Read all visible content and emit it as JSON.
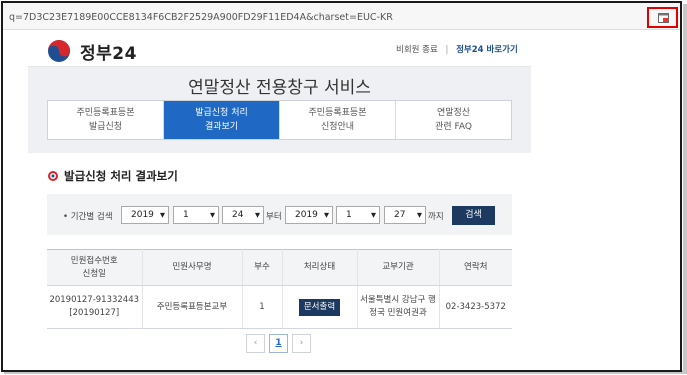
{
  "browser": {
    "url": "q=7D3C23E7189E00CCE8134F6CB2F2529A900FD29F11ED4A&charset=EUC-KR",
    "popup_icon": "popup-window-icon"
  },
  "header": {
    "logo_text": "정부24",
    "link_logout": "비회원 종료",
    "link_separator": "|",
    "link_gov24": "정부24 바로가기"
  },
  "service": {
    "title": "연말정산 전용창구 서비스",
    "tabs": [
      {
        "line1": "주민등록표등본",
        "line2": "발급신청",
        "active": false
      },
      {
        "line1": "발급신청 처리",
        "line2": "결과보기",
        "active": true
      },
      {
        "line1": "주민등록표등본",
        "line2": "신청안내",
        "active": false
      },
      {
        "line1": "연말정산",
        "line2": "관련 FAQ",
        "active": false
      }
    ]
  },
  "section": {
    "title": "발급신청 처리 결과보기"
  },
  "search": {
    "label": "• 기간별 검색",
    "from_year": "2019",
    "from_month": "1",
    "from_day": "24",
    "from_word": "부터",
    "to_year": "2019",
    "to_month": "1",
    "to_day": "27",
    "to_word": "까지",
    "button": "검색"
  },
  "table": {
    "headers": {
      "receipt_line1": "민원접수번호",
      "receipt_line2": "신청일",
      "service": "민원사무명",
      "copies": "부수",
      "status": "처리상태",
      "agency": "교부기관",
      "contact": "연락처"
    },
    "rows": [
      {
        "receipt_no": "20190127-91332443",
        "date": "[20190127]",
        "service": "주민등록표등본교부",
        "copies": "1",
        "status_button": "문서출력",
        "agency_line1": "서울특별시 강남구 행",
        "agency_line2": "정국 민원여권과",
        "contact": "02-3423-5372"
      }
    ]
  },
  "pager": {
    "prev": "‹",
    "current": "1",
    "next": "›"
  },
  "colors": {
    "accent_blue": "#1f68c4",
    "dark_button": "#1c3a5f",
    "highlight_red": "#e00000"
  }
}
